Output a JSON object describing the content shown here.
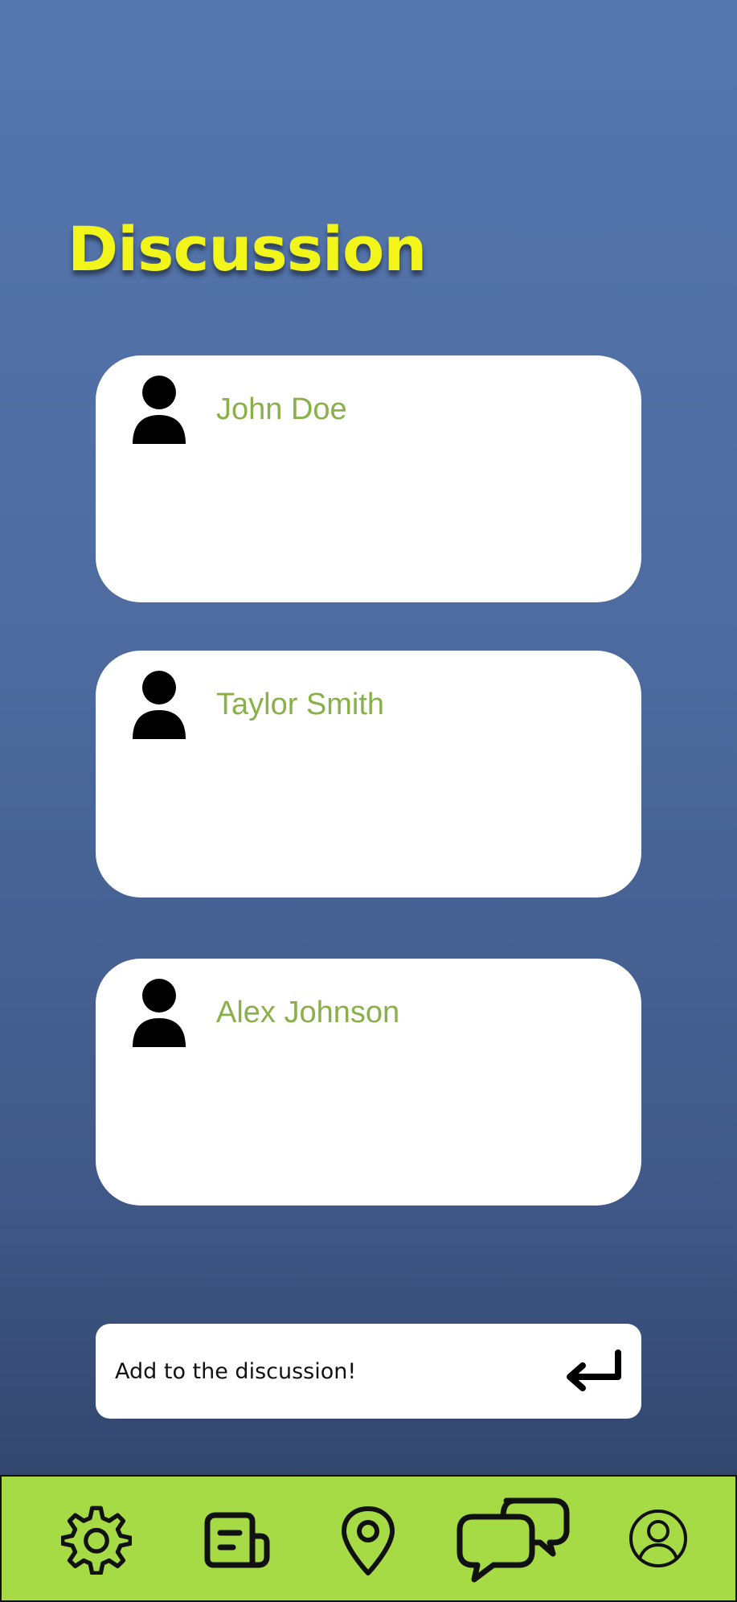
{
  "page": {
    "title": "Discussion"
  },
  "posts": [
    {
      "author": "John Doe"
    },
    {
      "author": "Taylor Smith"
    },
    {
      "author": "Alex Johnson"
    }
  ],
  "composer": {
    "placeholder": "Add to the discussion!",
    "send_icon": "return-arrow-icon"
  },
  "nav": {
    "items": [
      {
        "icon": "gear-icon"
      },
      {
        "icon": "newspaper-icon"
      },
      {
        "icon": "map-pin-icon"
      },
      {
        "icon": "chat-bubbles-icon",
        "active": true
      },
      {
        "icon": "user-circle-icon"
      }
    ]
  },
  "colors": {
    "title": "#f2f51a",
    "author_name": "#8ab04a",
    "nav_background": "#a6db46",
    "gradient_top": "#5577ae",
    "gradient_bottom": "#2d3f62"
  }
}
